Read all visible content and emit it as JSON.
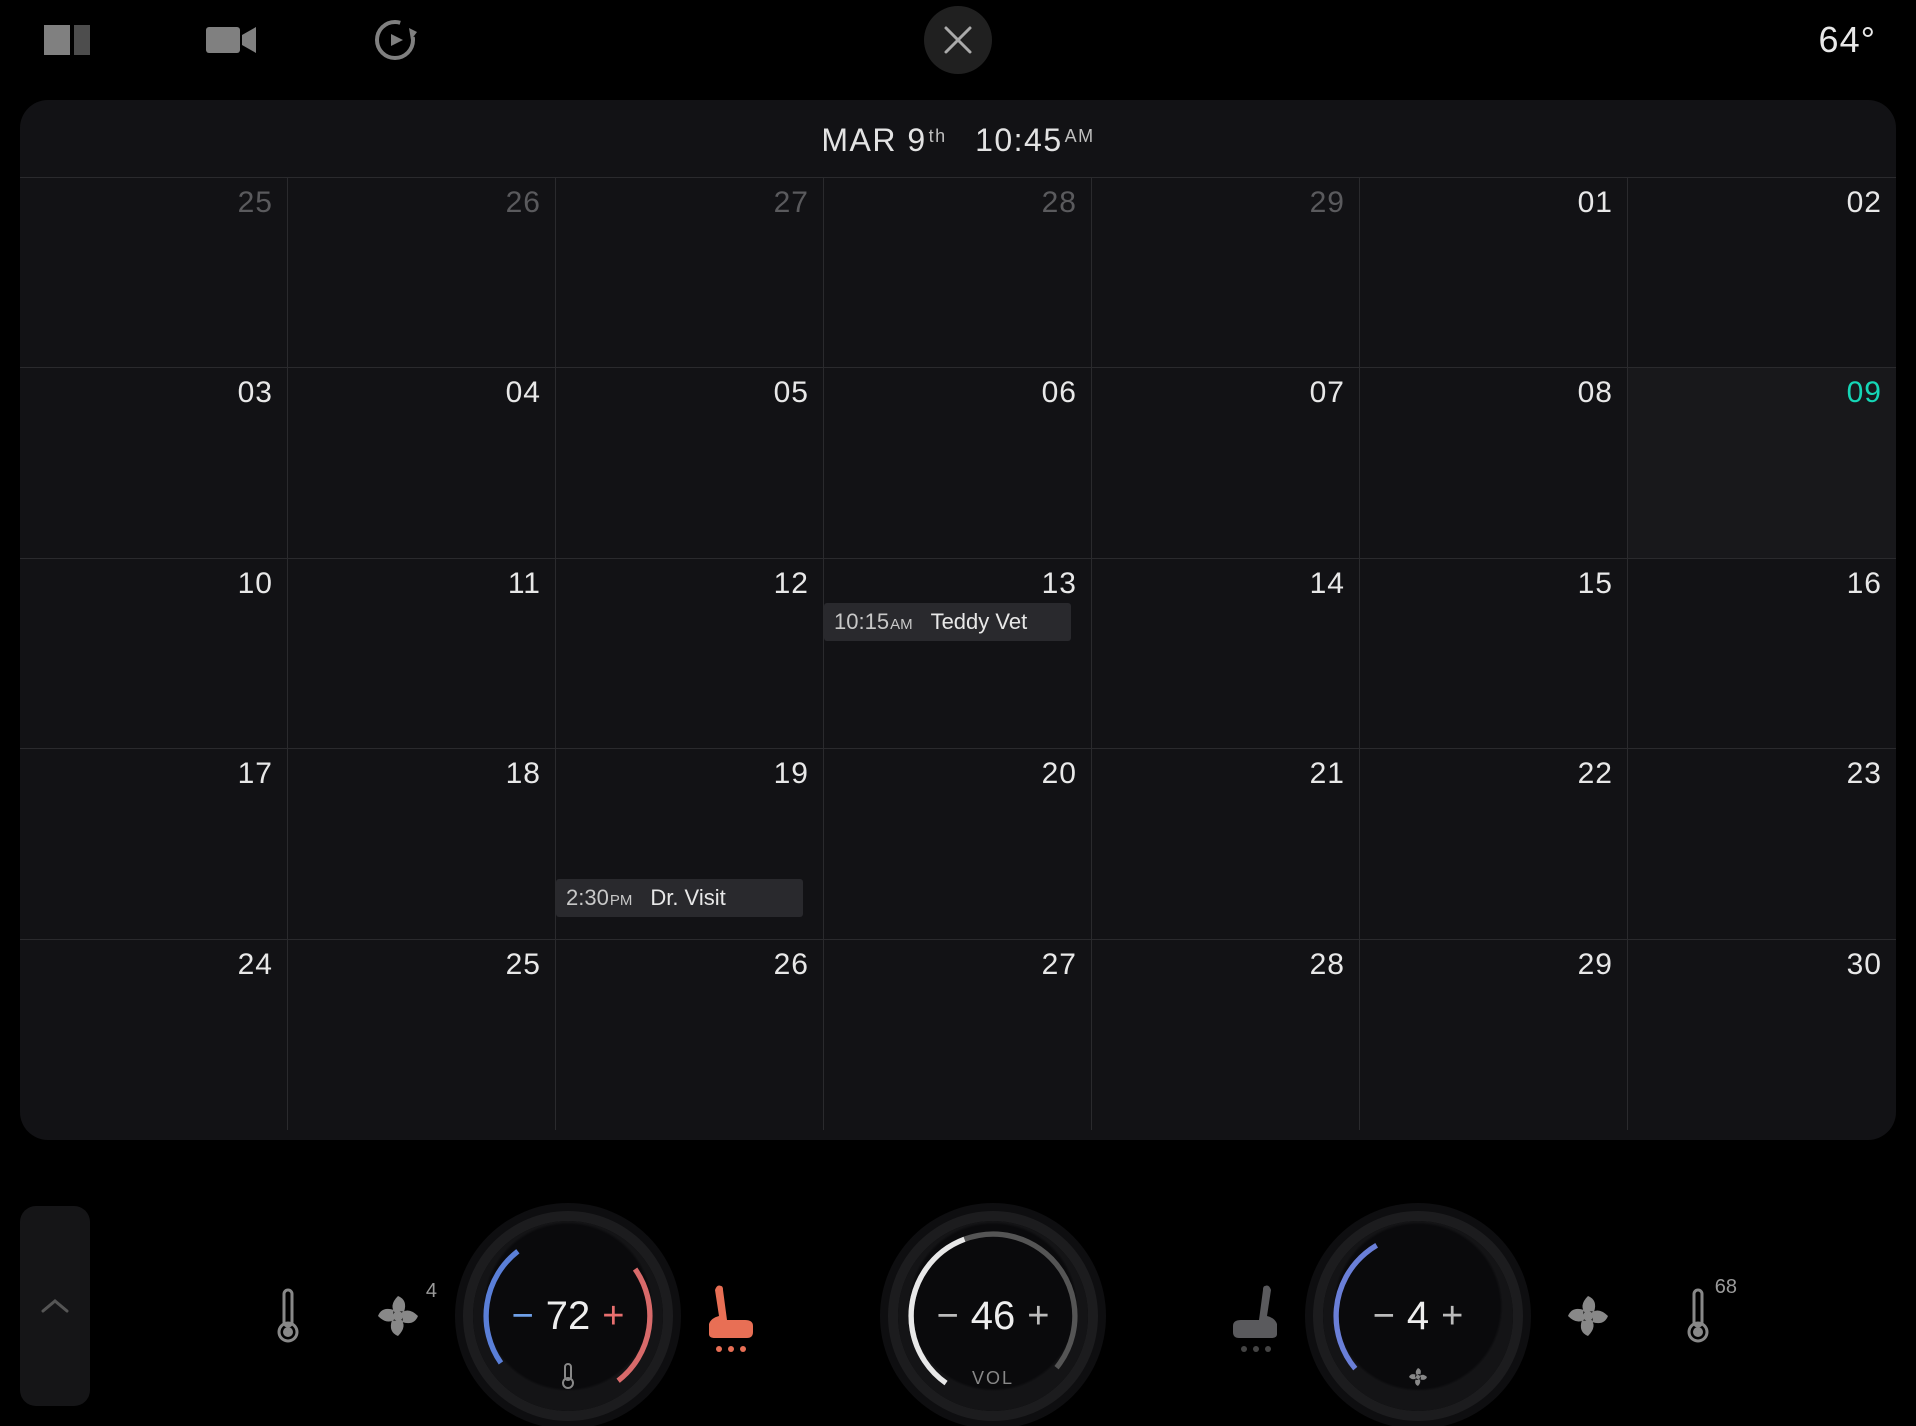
{
  "topbar": {
    "outside_temp": "64°"
  },
  "calendar": {
    "month": "MAR",
    "day": "9",
    "ordinal": "th",
    "time": "10:45",
    "ampm": "AM",
    "weeks": [
      [
        {
          "n": "25",
          "faded": true
        },
        {
          "n": "26",
          "faded": true
        },
        {
          "n": "27",
          "faded": true
        },
        {
          "n": "28",
          "faded": true
        },
        {
          "n": "29",
          "faded": true
        },
        {
          "n": "01",
          "faded": false
        },
        {
          "n": "02",
          "faded": false
        }
      ],
      [
        {
          "n": "03"
        },
        {
          "n": "04"
        },
        {
          "n": "05"
        },
        {
          "n": "06"
        },
        {
          "n": "07"
        },
        {
          "n": "08"
        },
        {
          "n": "09",
          "today": true
        }
      ],
      [
        {
          "n": "10"
        },
        {
          "n": "11"
        },
        {
          "n": "12"
        },
        {
          "n": "13",
          "event": {
            "time": "10:15",
            "ampm": "AM",
            "title": "Teddy Vet",
            "row": 1
          }
        },
        {
          "n": "14"
        },
        {
          "n": "15"
        },
        {
          "n": "16"
        }
      ],
      [
        {
          "n": "17"
        },
        {
          "n": "18"
        },
        {
          "n": "19",
          "event": {
            "time": "2:30",
            "ampm": "PM",
            "title": "Dr. Visit",
            "row": 2
          }
        },
        {
          "n": "20"
        },
        {
          "n": "21"
        },
        {
          "n": "22"
        },
        {
          "n": "23"
        }
      ],
      [
        {
          "n": "24"
        },
        {
          "n": "25"
        },
        {
          "n": "26"
        },
        {
          "n": "27"
        },
        {
          "n": "28"
        },
        {
          "n": "29"
        },
        {
          "n": "30"
        }
      ]
    ]
  },
  "dock": {
    "left_fan_badge": "4",
    "left_temp": "72",
    "volume": "46",
    "volume_label": "VOL",
    "right_value": "4",
    "right_temp_badge": "68"
  }
}
